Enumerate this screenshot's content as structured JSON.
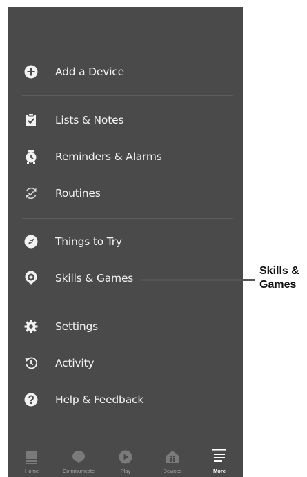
{
  "menu": {
    "items": [
      {
        "label": "Add a Device",
        "icon": "add-circle-icon"
      },
      {
        "label": "Lists & Notes",
        "icon": "clipboard-check-icon"
      },
      {
        "label": "Reminders & Alarms",
        "icon": "alarm-clock-icon"
      },
      {
        "label": "Routines",
        "icon": "routines-icon"
      },
      {
        "label": "Things to Try",
        "icon": "compass-icon"
      },
      {
        "label": "Skills & Games",
        "icon": "skills-star-icon"
      },
      {
        "label": "Settings",
        "icon": "gear-icon"
      },
      {
        "label": "Activity",
        "icon": "history-icon"
      },
      {
        "label": "Help & Feedback",
        "icon": "help-icon"
      }
    ]
  },
  "bottom_nav": {
    "items": [
      {
        "label": "Home",
        "icon": "home-icon",
        "active": false
      },
      {
        "label": "Communicate",
        "icon": "chat-bubble-icon",
        "active": false
      },
      {
        "label": "Play",
        "icon": "play-icon",
        "active": false
      },
      {
        "label": "Devices",
        "icon": "devices-icon",
        "active": false
      },
      {
        "label": "More",
        "icon": "menu-icon",
        "active": true
      }
    ]
  },
  "callout": {
    "line1": "Skills &",
    "line2": "Games"
  },
  "colors": {
    "background": "#4a4a4a",
    "text": "#f2f2f2",
    "nav_inactive": "#8a8a8a",
    "nav_active": "#ffffff"
  }
}
